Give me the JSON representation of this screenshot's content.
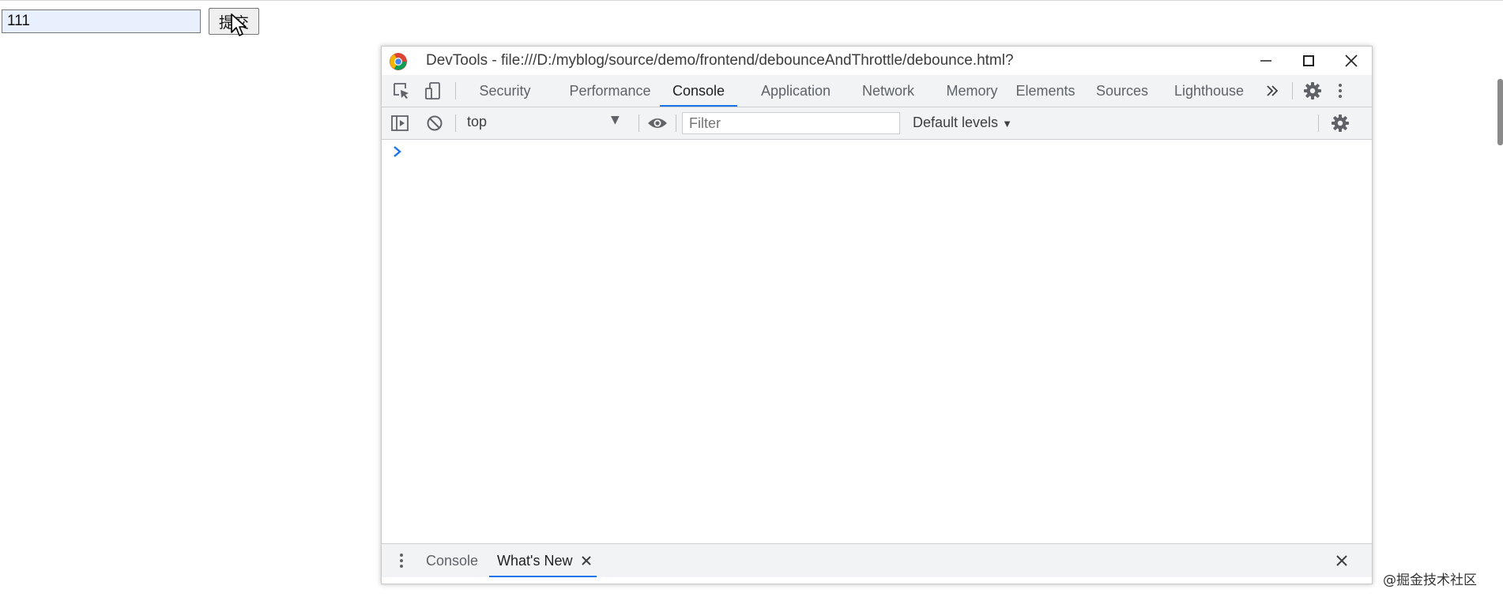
{
  "page": {
    "input_value": "111",
    "submit_label": "提交",
    "watermark": "@掘金技术社区"
  },
  "devtools": {
    "window_title": "DevTools - file:///D:/myblog/source/demo/frontend/debounceAndThrottle/debounce.html?",
    "tabs": [
      "Security",
      "Performance",
      "Console",
      "Application",
      "Network",
      "Memory",
      "Elements",
      "Sources",
      "Lighthouse"
    ],
    "active_tab": "Console",
    "toolbar": {
      "context": "top",
      "filter_placeholder": "Filter",
      "levels": "Default levels"
    },
    "drawer": {
      "tabs": [
        "Console",
        "What's New"
      ],
      "active_tab": "What's New"
    }
  },
  "colors": {
    "accent": "#1a73e8",
    "toolbar_bg": "#f1f3f4",
    "input_autofill_bg": "#e8f0fe"
  },
  "icons": [
    "cursor-icon",
    "chrome-logo-icon",
    "minimize-icon",
    "maximize-icon",
    "close-icon",
    "inspect-element-icon",
    "device-toolbar-icon",
    "more-tabs-icon",
    "gear-icon",
    "kebab-menu-icon",
    "sidebar-toggle-icon",
    "clear-console-icon",
    "eye-icon",
    "console-prompt-icon",
    "close-tab-icon",
    "close-drawer-icon"
  ]
}
